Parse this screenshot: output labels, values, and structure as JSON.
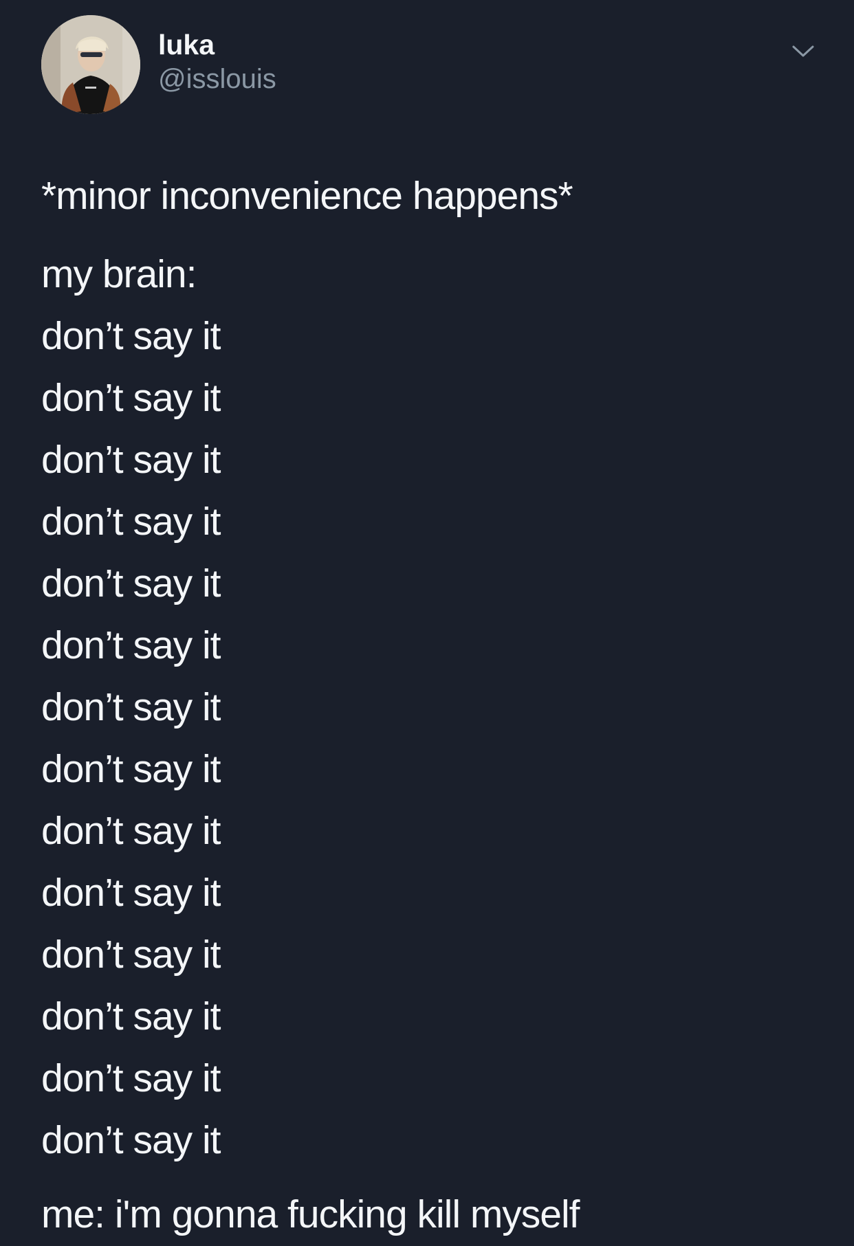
{
  "tweet": {
    "display_name": "luka",
    "handle": "@isslouis",
    "avatar_icon": "profile-photo",
    "menu_icon": "chevron-down-icon",
    "opening_line": "*minor inconvenience happens*",
    "brain_label": "my brain:",
    "repeated_lines": [
      "don’t say it",
      "don’t say it",
      "don’t say it",
      "don’t say it",
      "don’t say it",
      "don’t say it",
      "don’t say it",
      "don’t say it",
      "don’t say it",
      "don’t say it",
      "don’t say it",
      "don’t say it",
      "don’t say it",
      "don’t say it"
    ],
    "closing_line": "me: i'm gonna fucking kill myself"
  },
  "colors": {
    "background": "#1a1f2b",
    "text": "#f4f6f8",
    "secondary_text": "#8b98a5"
  }
}
